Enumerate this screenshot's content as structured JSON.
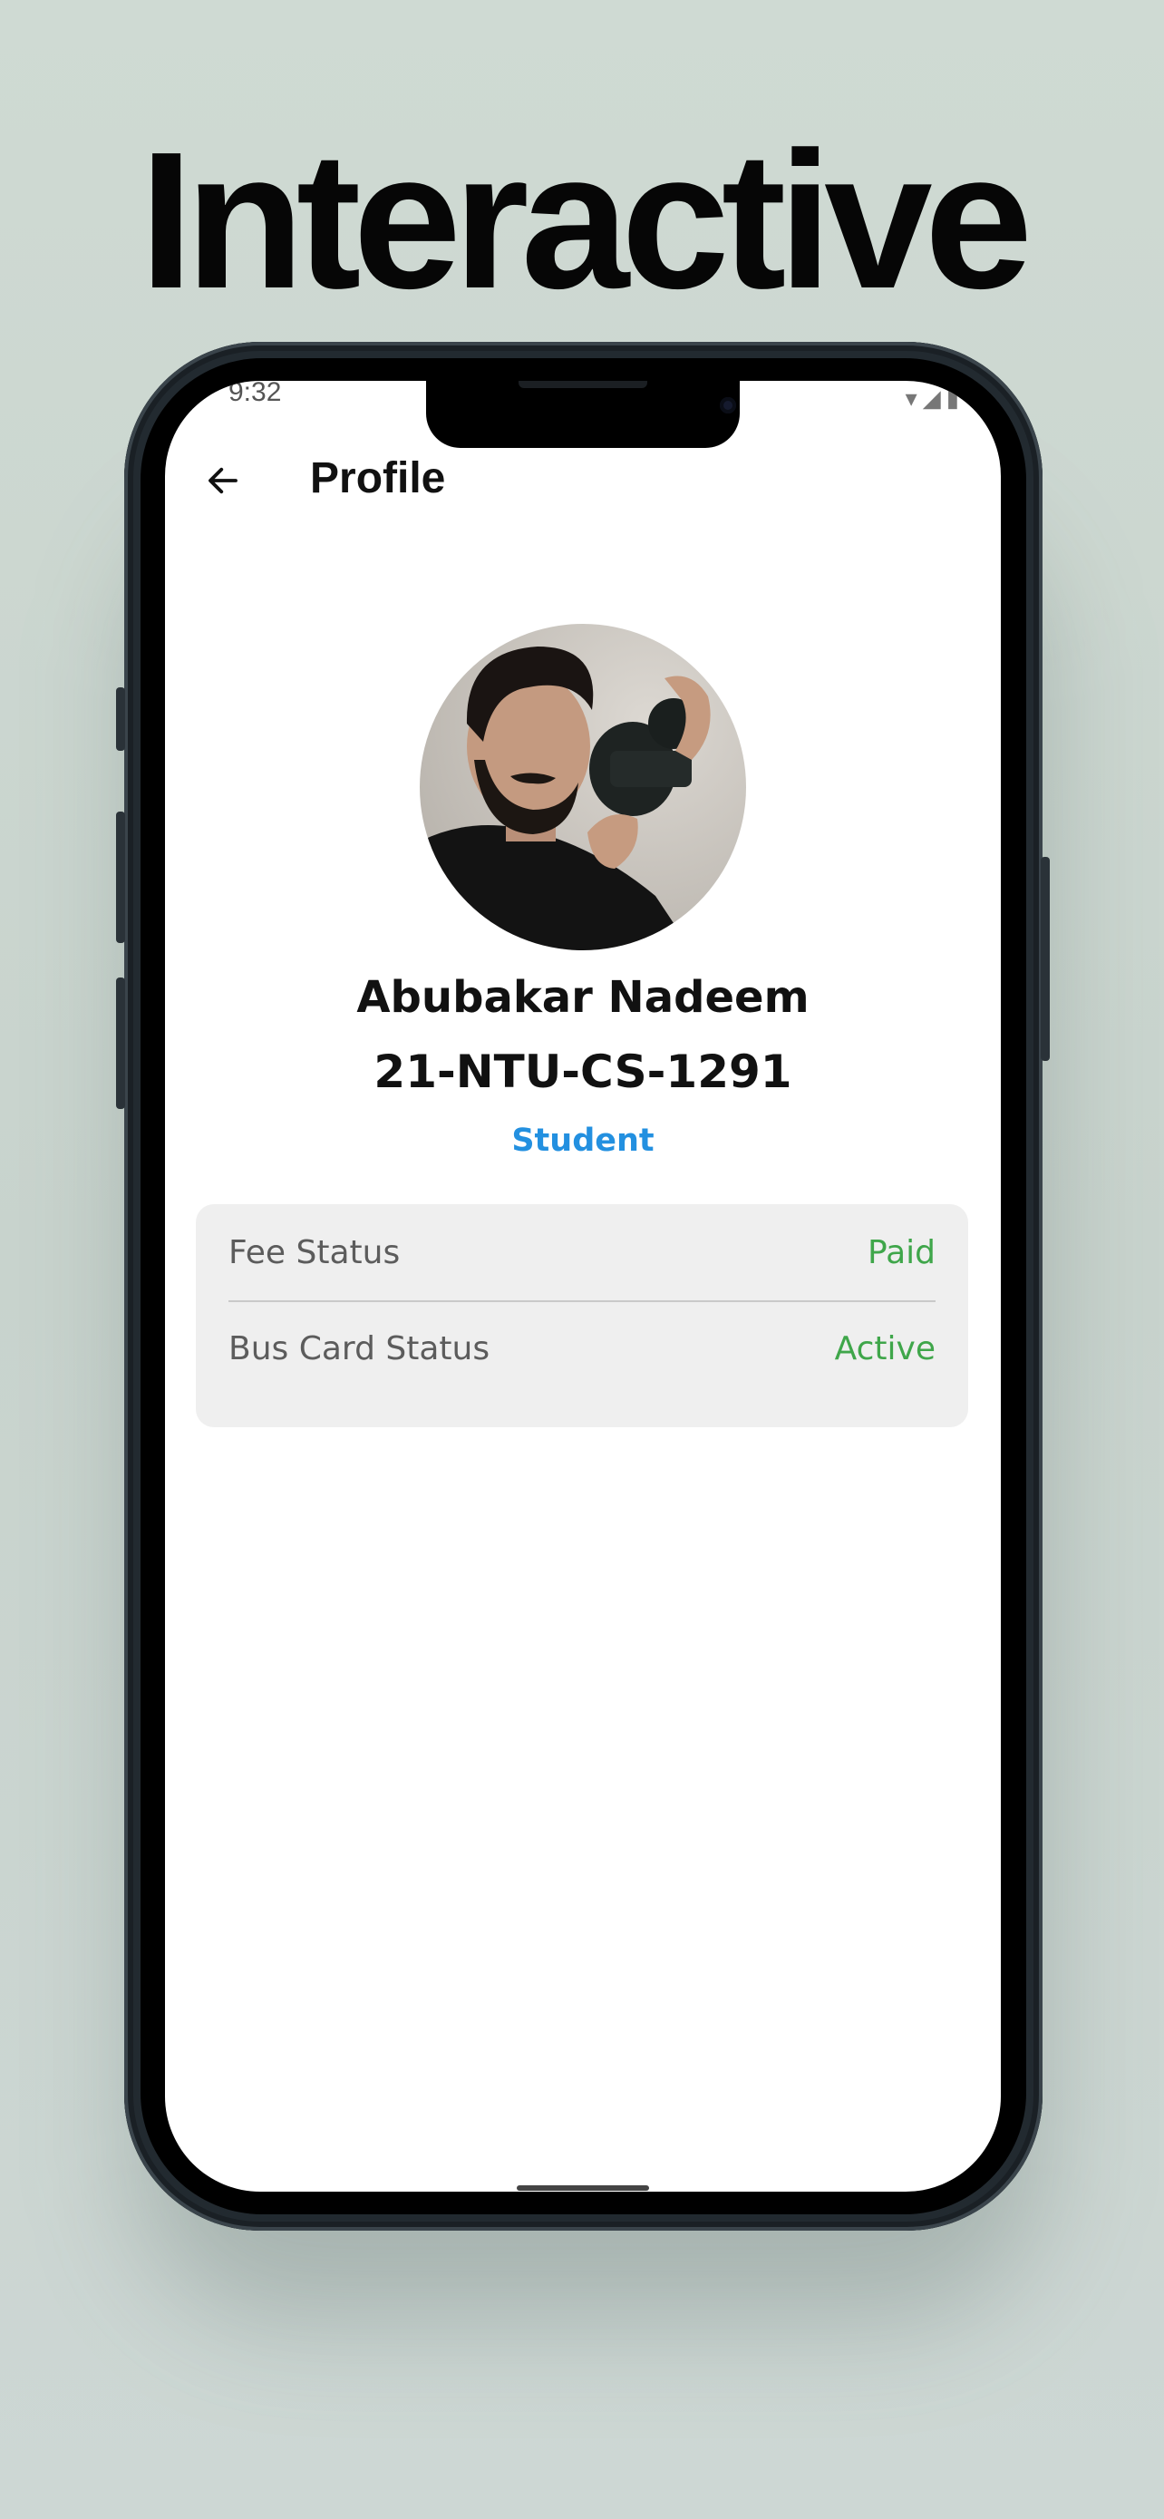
{
  "headline": "Interactive",
  "status_bar": {
    "time": "9:32"
  },
  "appbar": {
    "title": "Profile"
  },
  "profile": {
    "name": "Abubakar Nadeem",
    "roll_number": "21-NTU-CS-1291",
    "role": "Student"
  },
  "status_card": {
    "rows": [
      {
        "label": "Fee Status",
        "value": "Paid"
      },
      {
        "label": "Bus Card Status",
        "value": "Active"
      }
    ]
  },
  "colors": {
    "role_accent": "#2390e0",
    "status_value": "#3fa64a",
    "card_background": "#efefef"
  },
  "icons": [
    "arrow-left-icon",
    "wifi-icon",
    "signal-icon",
    "battery-icon"
  ]
}
